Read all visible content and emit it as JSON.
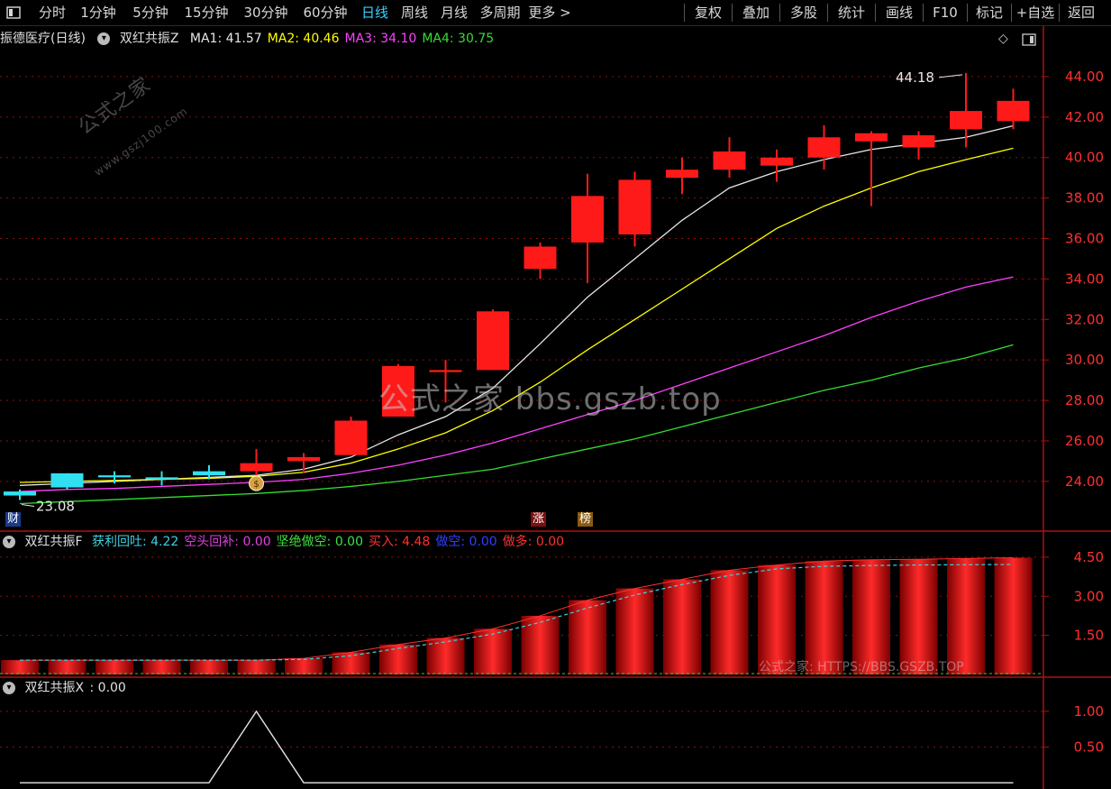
{
  "toolbar": {
    "left_icon": "panel-toggle-icon",
    "periods": [
      "分时",
      "1分钟",
      "5分钟",
      "15分钟",
      "30分钟",
      "60分钟",
      "日线",
      "周线",
      "月线",
      "多周期",
      "更多 >"
    ],
    "active_period": "日线",
    "actions": [
      "复权",
      "叠加",
      "多股",
      "统计",
      "画线",
      "F10",
      "标记",
      "+自选",
      "返回"
    ]
  },
  "main": {
    "stock_title": "振德医疗(日线)",
    "indicator_name": "双红共振Z",
    "ma_labels": [
      {
        "text": "MA1: 41.57",
        "color": "#e6e6e6"
      },
      {
        "text": "MA2: 40.46",
        "color": "#ffff00"
      },
      {
        "text": "MA3: 34.10",
        "color": "#ff40ff"
      },
      {
        "text": "MA4: 30.75",
        "color": "#33dd33"
      }
    ],
    "high_label": "44.18",
    "low_label": "23.08",
    "badges": {
      "cai": "财",
      "zhang": "涨",
      "bang": "榜"
    },
    "watermark_text": "公式之家 bbs.gszb.top",
    "small_watermark": "公式之家",
    "small_watermark_url": "www.gszj100.com"
  },
  "sub1": {
    "indicator_name": "双红共振F",
    "labels": [
      {
        "text": "获利回吐: 4.22",
        "color": "#40d0e0"
      },
      {
        "text": "空头回补: 0.00",
        "color": "#e040e0"
      },
      {
        "text": "坚绝做空: 0.00",
        "color": "#40e040"
      },
      {
        "text": "买入: 4.48",
        "color": "#ff3030"
      },
      {
        "text": "做空: 0.00",
        "color": "#3040ff"
      },
      {
        "text": "做多: 0.00",
        "color": "#ff3030"
      }
    ],
    "watermark": "公式之家: HTTPS://BBS.GSZB.TOP"
  },
  "sub2": {
    "indicator_name": "双红共振X",
    "value_label": ": 0.00"
  },
  "chart_data": [
    {
      "type": "candlestick",
      "title": "振德医疗(日线)",
      "y_ticks": [
        24,
        26,
        28,
        30,
        32,
        34,
        36,
        38,
        40,
        42,
        44
      ],
      "ylim": [
        22.3,
        45.2
      ],
      "candles": [
        {
          "o": 23.3,
          "h": 23.6,
          "l": 23.08,
          "c": 23.5,
          "color": "cyan"
        },
        {
          "o": 24.4,
          "h": 24.4,
          "l": 23.6,
          "c": 23.7,
          "color": "cyan"
        },
        {
          "o": 24.3,
          "h": 24.5,
          "l": 23.9,
          "c": 24.2,
          "color": "cyan"
        },
        {
          "o": 24.2,
          "h": 24.5,
          "l": 23.8,
          "c": 24.1,
          "color": "cyan"
        },
        {
          "o": 24.5,
          "h": 24.8,
          "l": 24.1,
          "c": 24.3,
          "color": "cyan"
        },
        {
          "o": 24.5,
          "h": 25.6,
          "l": 24.3,
          "c": 24.9,
          "color": "red"
        },
        {
          "o": 25.0,
          "h": 25.4,
          "l": 24.4,
          "c": 25.2,
          "color": "red"
        },
        {
          "o": 25.3,
          "h": 27.2,
          "l": 25.3,
          "c": 27.0,
          "color": "red"
        },
        {
          "o": 27.2,
          "h": 29.8,
          "l": 27.2,
          "c": 29.7,
          "color": "red"
        },
        {
          "o": 29.5,
          "h": 30.0,
          "l": 27.9,
          "c": 29.4,
          "color": "red"
        },
        {
          "o": 29.5,
          "h": 32.5,
          "l": 29.5,
          "c": 32.4,
          "color": "red"
        },
        {
          "o": 34.5,
          "h": 35.8,
          "l": 34.0,
          "c": 35.6,
          "color": "red"
        },
        {
          "o": 35.8,
          "h": 39.2,
          "l": 33.8,
          "c": 38.1,
          "color": "red"
        },
        {
          "o": 36.2,
          "h": 39.3,
          "l": 35.6,
          "c": 38.9,
          "color": "red"
        },
        {
          "o": 39.0,
          "h": 40.0,
          "l": 38.2,
          "c": 39.4,
          "color": "red"
        },
        {
          "o": 39.4,
          "h": 41.0,
          "l": 39.0,
          "c": 40.3,
          "color": "red"
        },
        {
          "o": 39.6,
          "h": 40.4,
          "l": 38.8,
          "c": 40.0,
          "color": "red"
        },
        {
          "o": 40.0,
          "h": 41.6,
          "l": 39.4,
          "c": 41.0,
          "color": "red"
        },
        {
          "o": 40.8,
          "h": 41.3,
          "l": 37.6,
          "c": 41.2,
          "color": "red"
        },
        {
          "o": 40.5,
          "h": 41.3,
          "l": 39.9,
          "c": 41.1,
          "color": "red"
        },
        {
          "o": 41.4,
          "h": 44.18,
          "l": 40.5,
          "c": 42.3,
          "color": "red"
        },
        {
          "o": 41.8,
          "h": 43.4,
          "l": 41.4,
          "c": 42.8,
          "color": "red"
        }
      ],
      "ma_series": [
        {
          "name": "MA1",
          "color": "#e6e6e6",
          "values": [
            23.8,
            23.9,
            24.0,
            24.1,
            24.2,
            24.3,
            24.6,
            25.2,
            26.3,
            27.2,
            28.6,
            30.8,
            33.1,
            35.0,
            36.9,
            38.5,
            39.3,
            39.9,
            40.4,
            40.7,
            41.0,
            41.57
          ]
        },
        {
          "name": "MA2",
          "color": "#ffff00",
          "values": [
            23.95,
            24.0,
            24.05,
            24.1,
            24.15,
            24.25,
            24.45,
            24.9,
            25.6,
            26.4,
            27.5,
            28.9,
            30.5,
            32.0,
            33.5,
            35.0,
            36.5,
            37.6,
            38.5,
            39.3,
            39.9,
            40.46
          ]
        },
        {
          "name": "MA3",
          "color": "#ff40ff",
          "values": [
            23.5,
            23.6,
            23.65,
            23.75,
            23.85,
            23.95,
            24.1,
            24.4,
            24.8,
            25.3,
            25.9,
            26.6,
            27.3,
            28.0,
            28.8,
            29.6,
            30.4,
            31.2,
            32.1,
            32.9,
            33.6,
            34.1
          ]
        },
        {
          "name": "MA4",
          "color": "#33dd33",
          "values": [
            22.9,
            23.0,
            23.1,
            23.2,
            23.3,
            23.4,
            23.55,
            23.75,
            24.0,
            24.3,
            24.6,
            25.1,
            25.6,
            26.1,
            26.7,
            27.3,
            27.9,
            28.5,
            29.0,
            29.6,
            30.1,
            30.75
          ]
        }
      ]
    },
    {
      "type": "bar",
      "title": "双红共振F",
      "y_ticks": [
        1.5,
        3.0,
        4.5
      ],
      "ylim": [
        0,
        4.6
      ],
      "series": [
        {
          "name": "买入",
          "color": "#ff2020",
          "values": [
            0.55,
            0.55,
            0.55,
            0.55,
            0.55,
            0.55,
            0.62,
            0.85,
            1.15,
            1.4,
            1.75,
            2.25,
            2.85,
            3.3,
            3.65,
            4.0,
            4.2,
            4.35,
            4.4,
            4.42,
            4.45,
            4.48
          ]
        },
        {
          "name": "获利回吐",
          "color": "#40d0e0",
          "values": [
            0.55,
            0.55,
            0.55,
            0.55,
            0.55,
            0.55,
            0.58,
            0.72,
            1.0,
            1.25,
            1.55,
            2.0,
            2.55,
            3.05,
            3.45,
            3.8,
            4.05,
            4.15,
            4.18,
            4.2,
            4.21,
            4.22
          ]
        }
      ]
    },
    {
      "type": "line",
      "title": "双红共振X",
      "y_ticks": [
        0.5,
        1.0
      ],
      "ylim": [
        -0.05,
        1.2
      ],
      "series": [
        {
          "name": "双红共振X",
          "color": "#e6e6e6",
          "values": [
            0,
            0,
            0,
            0,
            0,
            1,
            0,
            0,
            0,
            0,
            0,
            0,
            0,
            0,
            0,
            0,
            0,
            0,
            0,
            0,
            0,
            0
          ]
        }
      ]
    }
  ]
}
